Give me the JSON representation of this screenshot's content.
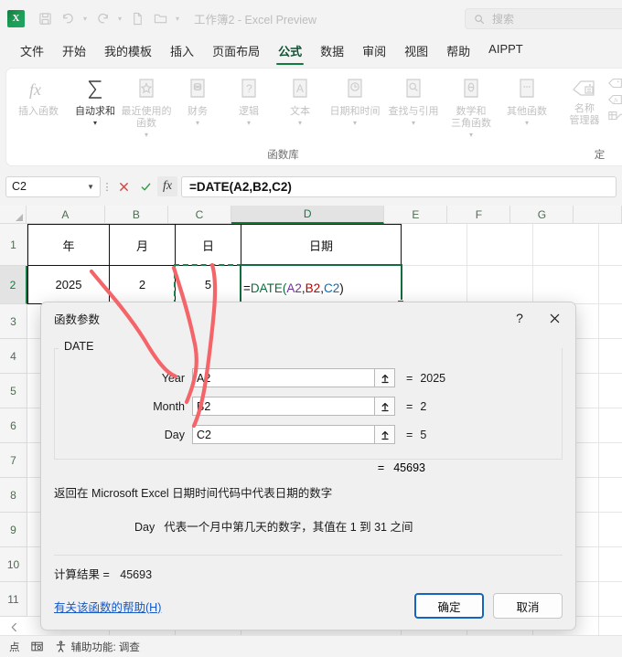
{
  "titlebar": {
    "app_icon": "excel-logo",
    "doc_title": "工作簿2  -  Excel Preview",
    "quick_access": [
      {
        "name": "save-icon",
        "label": "保存"
      },
      {
        "name": "undo-icon",
        "label": "撤消"
      },
      {
        "name": "redo-icon",
        "label": "恢复"
      },
      {
        "name": "new-icon",
        "label": "新建"
      },
      {
        "name": "open-icon",
        "label": "打开"
      },
      {
        "name": "customize-qat-icon",
        "label": "自定义快速访问工具栏"
      }
    ]
  },
  "search": {
    "placeholder": "搜索",
    "icon": "search-icon"
  },
  "ribbon_tabs": [
    {
      "label": "文件",
      "active": false
    },
    {
      "label": "开始",
      "active": false
    },
    {
      "label": "我的模板",
      "active": false
    },
    {
      "label": "插入",
      "active": false
    },
    {
      "label": "页面布局",
      "active": false
    },
    {
      "label": "公式",
      "active": true
    },
    {
      "label": "数据",
      "active": false
    },
    {
      "label": "审阅",
      "active": false
    },
    {
      "label": "视图",
      "active": false
    },
    {
      "label": "帮助",
      "active": false
    },
    {
      "label": "AIPPT",
      "active": false
    }
  ],
  "ribbon": {
    "function_library": {
      "group_label": "函数库",
      "buttons": [
        {
          "label": "插入函数",
          "icon": "fx-icon",
          "caret": false
        },
        {
          "label": "自动求和",
          "icon": "sigma-icon",
          "caret": true
        },
        {
          "label": "最近使用的\n函数",
          "line1": "最近使用的",
          "line2": "函数",
          "icon": "star-book-icon",
          "caret": true
        },
        {
          "label": "财务",
          "icon": "finance-book-icon",
          "caret": true
        },
        {
          "label": "逻辑",
          "icon": "question-book-icon",
          "caret": true
        },
        {
          "label": "文本",
          "icon": "text-book-icon",
          "caret": true
        },
        {
          "label": "日期和时间",
          "icon": "clock-book-icon",
          "caret": true
        },
        {
          "label": "查找与引用",
          "icon": "lookup-book-icon",
          "caret": true
        },
        {
          "label": "数学和\n三角函数",
          "line1": "数学和",
          "line2": "三角函数",
          "icon": "theta-book-icon",
          "caret": true
        },
        {
          "label": "其他函数",
          "icon": "more-book-icon",
          "caret": true
        }
      ]
    },
    "defined_names": {
      "group_label": "定",
      "name_manager": {
        "line1": "名称",
        "line2": "管理器",
        "icon": "name-manager-icon"
      },
      "small_items": [
        {
          "icon": "define-name-icon"
        },
        {
          "icon": "use-in-formula-icon"
        },
        {
          "icon": "create-from-selection-icon"
        }
      ]
    }
  },
  "formula_bar": {
    "name_box_value": "C2",
    "cancel_icon": "cancel-x-icon",
    "confirm_icon": "confirm-check-icon",
    "fx_icon": "fx-icon",
    "formula": "=DATE(A2,B2,C2)"
  },
  "grid": {
    "columns": [
      "A",
      "B",
      "C",
      "D",
      "E",
      "F",
      "G"
    ],
    "active_column": "D",
    "active_row": "2",
    "rows": [
      "1",
      "2",
      "3",
      "4",
      "5",
      "6",
      "7",
      "8",
      "9",
      "10",
      "11"
    ],
    "cells": {
      "A1": "年",
      "B1": "月",
      "C1": "日",
      "D1": "日期",
      "A2": "2025",
      "B2": "2",
      "C2": "5",
      "D2_formula": "=DATE(A2,B2,C2)",
      "D2_parts": {
        "eq": "=",
        "fn": "DATE(",
        "a": "A2",
        "c1": ",",
        "b": "B2",
        "c2": ",",
        "c": "C2",
        "close": ")"
      }
    }
  },
  "dialog": {
    "title": "函数参数",
    "help_btn": "?",
    "close_btn": "✕",
    "function_name": "DATE",
    "args": [
      {
        "label": "Year",
        "value": "A2",
        "result": "2025",
        "collapse_icon": "collapse-dialog-icon"
      },
      {
        "label": "Month",
        "value": "B2",
        "result": "2",
        "collapse_icon": "collapse-dialog-icon"
      },
      {
        "label": "Day",
        "value": "C2",
        "result": "5",
        "collapse_icon": "collapse-dialog-icon"
      }
    ],
    "equals_sign": "=",
    "total_result": "45693",
    "description": "返回在 Microsoft Excel 日期时间代码中代表日期的数字",
    "arg_help_name": "Day",
    "arg_help_text": "代表一个月中第几天的数字，其值在 1 到 31 之间",
    "calc_result_label": "计算结果 =",
    "calc_result_value": "45693",
    "help_link": "有关该函数的帮助(H)",
    "ok_label": "确定",
    "cancel_label": "取消"
  },
  "status_bar": {
    "mode": "点",
    "icons": [
      "record-macro-icon",
      "accessibility-icon"
    ],
    "accessibility": "辅助功能: 调查"
  },
  "sheet_nav": {
    "prev_icon": "chevron-left-icon"
  },
  "colors": {
    "excel_green": "#107c41",
    "accent_border": "#136c3b",
    "annotation_red": "#f4656a",
    "link_blue": "#1558c4"
  }
}
